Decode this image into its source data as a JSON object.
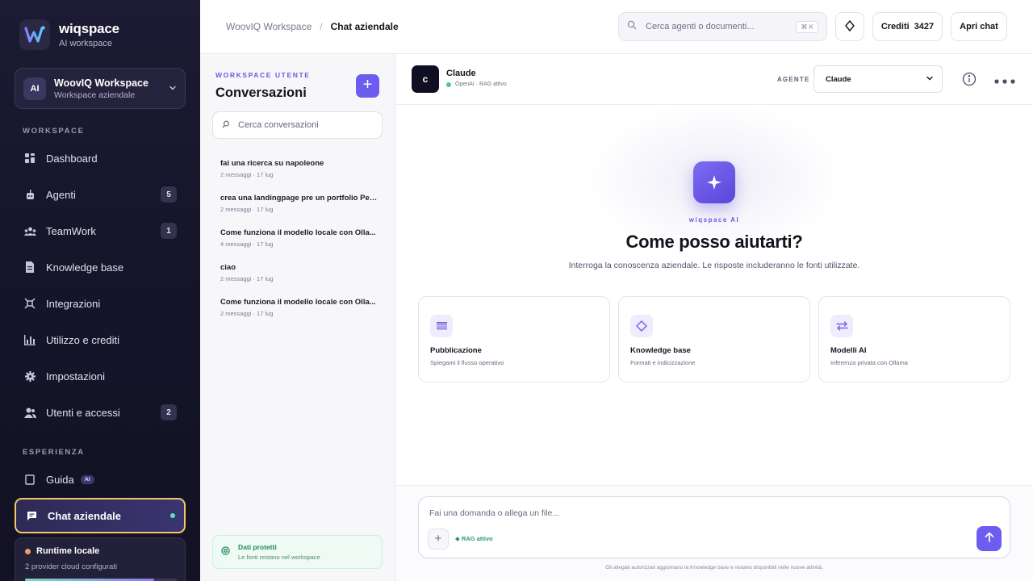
{
  "brand": {
    "name": "wiqspace",
    "sub": "AI workspace"
  },
  "workspace_switch": {
    "avatar": "AI",
    "name": "WoovIQ Workspace",
    "sub": "Workspace aziendale"
  },
  "sidebar": {
    "section_workspace": "WORKSPACE",
    "section_experience": "ESPERIENZA",
    "items": [
      {
        "label": "Dashboard",
        "icon": "grid-icon",
        "badge": ""
      },
      {
        "label": "Agenti",
        "icon": "bot-icon",
        "badge": "5"
      },
      {
        "label": "TeamWork",
        "icon": "team-icon",
        "badge": "1"
      },
      {
        "label": "Knowledge base",
        "icon": "document-icon",
        "badge": ""
      },
      {
        "label": "Integrazioni",
        "icon": "plug-icon",
        "badge": ""
      },
      {
        "label": "Utilizzo e crediti",
        "icon": "bar-chart-icon",
        "badge": ""
      },
      {
        "label": "Impostazioni",
        "icon": "gear-icon",
        "badge": ""
      },
      {
        "label": "Utenti e accessi",
        "icon": "users-icon",
        "badge": "2"
      }
    ],
    "guide": {
      "label": "Guida",
      "chip": "AI"
    },
    "chat": {
      "label": "Chat aziendale"
    },
    "runtime": {
      "title": "Runtime locale",
      "sub": "2 provider cloud configurati",
      "progress": 0.85
    }
  },
  "header": {
    "breadcrumb": [
      "WoovIQ Workspace",
      "Chat aziendale"
    ],
    "search_placeholder": "Cerca agenti o documenti...",
    "search_shortcut": "⌘ K",
    "credits_label": "Crediti",
    "credits_value": "3427",
    "open_chat": "Apri chat"
  },
  "conversations": {
    "eyebrow": "WORKSPACE UTENTE",
    "title": "Conversazioni",
    "search_placeholder": "Cerca conversazioni",
    "items": [
      {
        "title": "fai una ricerca su napoleone",
        "meta": "2 messaggi · 17 lug"
      },
      {
        "title": "crea una landingpage pre un portfolio Per...",
        "meta": "2 messaggi · 17 lug"
      },
      {
        "title": "Come funziona il modello locale con Olla...",
        "meta": "4 messaggi · 17 lug"
      },
      {
        "title": "ciao",
        "meta": "2 messaggi · 17 lug"
      },
      {
        "title": "Come funziona il modello locale con Olla...",
        "meta": "2 messaggi · 17 lug"
      }
    ],
    "protected": {
      "title": "Dati protetti",
      "sub": "Le fonti restano nel workspace"
    }
  },
  "chat": {
    "agent": {
      "avatar": "c",
      "name": "Claude",
      "status": "OpenAI · RAG attivo"
    },
    "agent_label": "AGENTE",
    "agent_selected": "Claude",
    "hero": {
      "eyebrow": "wiqspace AI",
      "title": "Come posso aiutarti?",
      "subtitle": "Interroga la conoscenza aziendale. Le risposte includeranno le fonti utilizzate."
    },
    "cards": [
      {
        "title": "Pubblicazione",
        "sub": "Spiegami il flusso operativo",
        "icon": "list-icon"
      },
      {
        "title": "Knowledge base",
        "sub": "Formati e indicizzazione",
        "icon": "diamond-icon"
      },
      {
        "title": "Modelli AI",
        "sub": "Inferenza privata con Ollama",
        "icon": "swap-icon"
      }
    ],
    "composer": {
      "placeholder": "Fai una domanda o allega un file...",
      "rag": "◆ RAG attivo",
      "footer": "Gli allegati autorizzati aggiornano la Knowledge base e restano disponibili nelle nuove attività."
    }
  },
  "colors": {
    "accent": "#6d5cf0",
    "sidebar_bg": "#1a1930",
    "active_border": "#f2c76a",
    "success": "#49c796"
  }
}
